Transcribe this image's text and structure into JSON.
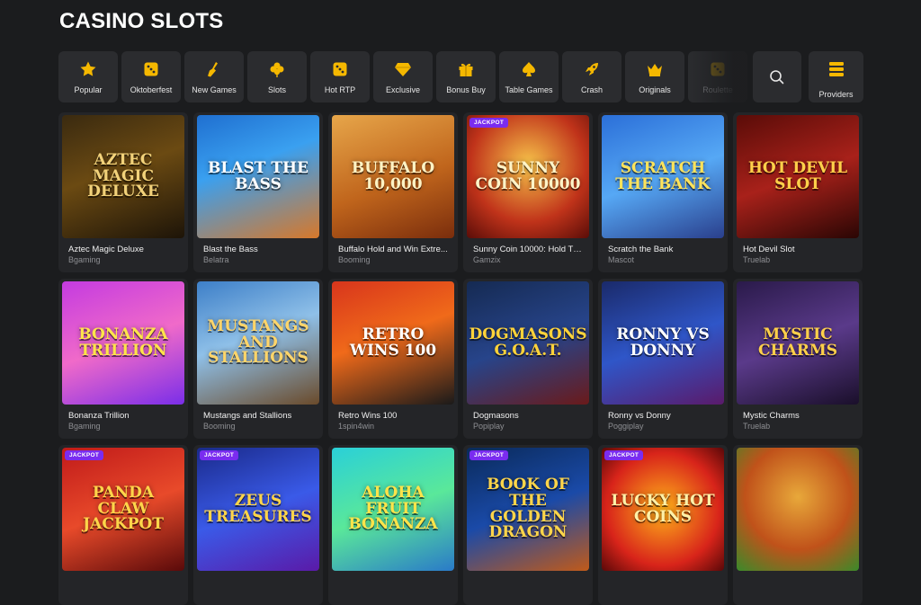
{
  "page": {
    "title": "CASINO SLOTS"
  },
  "categories": [
    {
      "label": "Popular",
      "icon": "star-icon"
    },
    {
      "label": "Oktoberfest",
      "icon": "dice-icon"
    },
    {
      "label": "New Games",
      "icon": "broom-icon"
    },
    {
      "label": "Slots",
      "icon": "clover-icon"
    },
    {
      "label": "Hot RTP",
      "icon": "dice-icon"
    },
    {
      "label": "Exclusive",
      "icon": "diamond-icon"
    },
    {
      "label": "Bonus Buy",
      "icon": "gift-icon"
    },
    {
      "label": "Table Games",
      "icon": "spade-icon"
    },
    {
      "label": "Crash",
      "icon": "rocket-icon"
    },
    {
      "label": "Originals",
      "icon": "crown-icon"
    },
    {
      "label": "Roulette",
      "icon": "dice-icon"
    }
  ],
  "search": {
    "icon": "search-icon"
  },
  "providers_button": {
    "label": "Providers",
    "icon": "stack-icon"
  },
  "games": [
    {
      "name": "Aztec Magic Deluxe",
      "provider": "Bgaming",
      "art": "Aztec Magic Deluxe",
      "jackpot": false
    },
    {
      "name": "Blast the Bass",
      "provider": "Belatra",
      "art": "Blast the Bass",
      "jackpot": false
    },
    {
      "name": "Buffalo Hold and Win Extre...",
      "provider": "Booming",
      "art": "Buffalo 10,000",
      "jackpot": false
    },
    {
      "name": "Sunny Coin 10000: Hold Th...",
      "provider": "Gamzix",
      "art": "Sunny Coin 10000",
      "jackpot": true
    },
    {
      "name": "Scratch the Bank",
      "provider": "Mascot",
      "art": "Scratch the Bank",
      "jackpot": false
    },
    {
      "name": "Hot Devil Slot",
      "provider": "Truelab",
      "art": "Hot Devil Slot",
      "jackpot": false
    },
    {
      "name": "Bonanza Trillion",
      "provider": "Bgaming",
      "art": "Bonanza Trillion",
      "jackpot": false
    },
    {
      "name": "Mustangs and Stallions",
      "provider": "Booming",
      "art": "Mustangs and Stallions",
      "jackpot": false
    },
    {
      "name": "Retro Wins 100",
      "provider": "1spin4win",
      "art": "Retro Wins 100",
      "jackpot": false
    },
    {
      "name": "Dogmasons",
      "provider": "Popiplay",
      "art": "Dogmasons G.O.A.T.",
      "jackpot": false
    },
    {
      "name": "Ronny vs Donny",
      "provider": "Poggiplay",
      "art": "Ronny vs Donny",
      "jackpot": false
    },
    {
      "name": "Mystic Charms",
      "provider": "Truelab",
      "art": "Mystic Charms",
      "jackpot": false
    },
    {
      "name": "",
      "provider": "",
      "art": "Panda Claw Jackpot",
      "jackpot": true
    },
    {
      "name": "",
      "provider": "",
      "art": "Zeus Treasures",
      "jackpot": true
    },
    {
      "name": "",
      "provider": "",
      "art": "Aloha Fruit Bonanza",
      "jackpot": false
    },
    {
      "name": "",
      "provider": "",
      "art": "Book of the Golden Dragon",
      "jackpot": true
    },
    {
      "name": "",
      "provider": "",
      "art": "Lucky Hot Coins",
      "jackpot": true
    },
    {
      "name": "",
      "provider": "",
      "art": "",
      "jackpot": false
    }
  ],
  "badge_label": "JACKPOT",
  "colors": {
    "background": "#1b1c1e",
    "card": "#242528",
    "jackpot_badge": "#7a2cf0",
    "icon_gold": "#f5b800"
  }
}
